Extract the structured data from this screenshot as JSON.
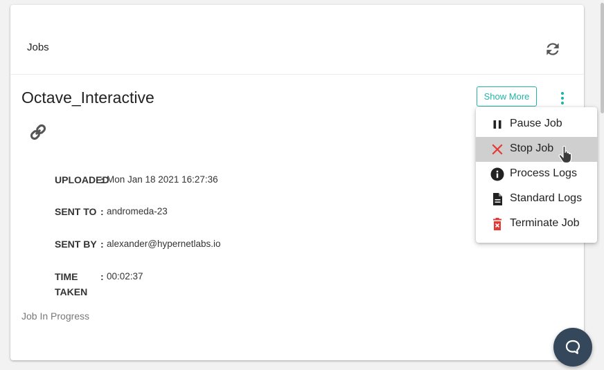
{
  "header": {
    "title": "Jobs"
  },
  "job": {
    "name": "Octave_Interactive",
    "show_more_label": "Show More",
    "status": "Job In Progress",
    "details": {
      "uploaded": {
        "label": "UPLOADED",
        "colon": ":",
        "value": "Mon Jan 18 2021 16:27:36"
      },
      "sent_to": {
        "label": "SENT TO",
        "colon": ":",
        "value": "andromeda-23"
      },
      "sent_by": {
        "label": "SENT BY",
        "colon": ":",
        "value": "alexander@hypernetlabs.io"
      },
      "time_taken": {
        "label_line1": "TIME",
        "label_line2": "TAKEN",
        "colon": ":",
        "value": "00:02:37"
      }
    }
  },
  "menu": {
    "items": [
      {
        "label": "Pause Job",
        "icon": "pause-icon"
      },
      {
        "label": "Stop Job",
        "icon": "close-icon",
        "highlighted": true
      },
      {
        "label": "Process Logs",
        "icon": "info-icon"
      },
      {
        "label": "Standard Logs",
        "icon": "document-icon"
      },
      {
        "label": "Terminate Job",
        "icon": "trash-icon"
      }
    ]
  },
  "colors": {
    "accent": "#21b5a9",
    "danger": "#e53935",
    "chat_button": "#35475a",
    "menu_hover": "#cfcfcf"
  },
  "icons": {
    "refresh": "refresh-icon",
    "link": "link-icon",
    "kebab": "more-vertical-icon",
    "chat": "chat-icon",
    "cursor": "hand-pointer-icon"
  }
}
